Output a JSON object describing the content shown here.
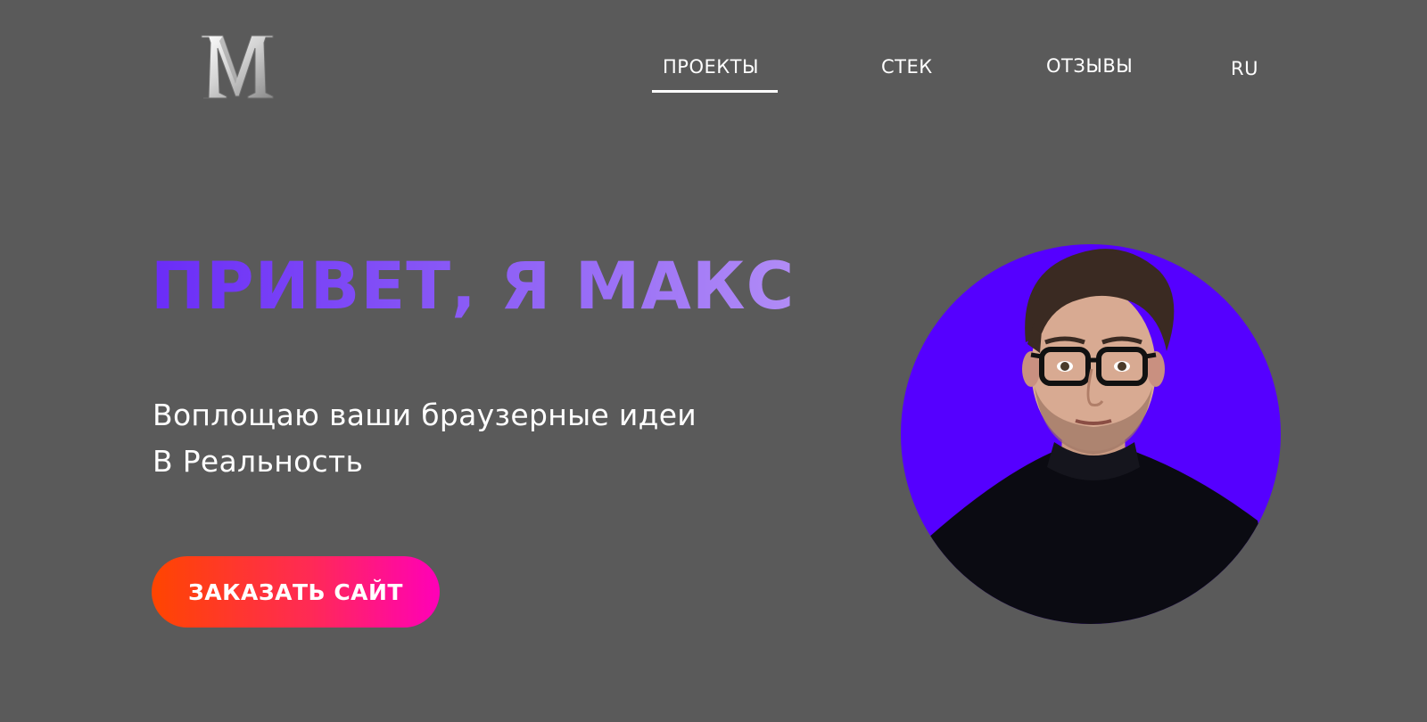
{
  "header": {
    "logo_icon": "m-letter-logo-icon",
    "nav": {
      "projects": "ПРОЕКТЫ",
      "stack": "СТЕК",
      "reviews": "ОТЗЫВЫ",
      "language": "RU"
    },
    "active_nav": "projects"
  },
  "hero": {
    "title": "ПРИВЕТ, Я МАКС",
    "subtitle_line1": "Воплощаю ваши браузерные идеи",
    "subtitle_line2": "В Реальность",
    "cta_label": "ЗАКАЗАТЬ САЙТ"
  },
  "avatar": {
    "icon": "portrait-photo",
    "background_color": "#5500ff"
  },
  "colors": {
    "page_background": "#5a5a5a",
    "title_gradient_start": "#6a2cf7",
    "title_gradient_end": "#b18cf6",
    "cta_gradient_start": "#ff4500",
    "cta_gradient_end": "#ff00b8",
    "nav_text": "#ffffff"
  }
}
